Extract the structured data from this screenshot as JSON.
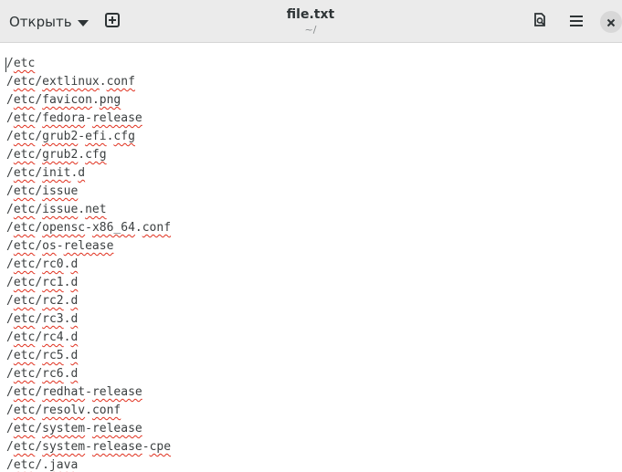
{
  "header": {
    "open_label": "Открыть",
    "title": "file.txt",
    "subtitle": "~/",
    "icons": {
      "open_dropdown": "chevron-down-icon",
      "new_tab": "new-tab-icon",
      "search": "search-icon",
      "menu": "hamburger-menu-icon",
      "close": "close-icon"
    }
  },
  "editor": {
    "lines": [
      "/etc",
      "/etc/extlinux.conf",
      "/etc/favicon.png",
      "/etc/fedora-release",
      "/etc/grub2-efi.cfg",
      "/etc/grub2.cfg",
      "/etc/init.d",
      "/etc/issue",
      "/etc/issue.net",
      "/etc/opensc-x86_64.conf",
      "/etc/os-release",
      "/etc/rc0.d",
      "/etc/rc1.d",
      "/etc/rc2.d",
      "/etc/rc3.d",
      "/etc/rc4.d",
      "/etc/rc5.d",
      "/etc/rc6.d",
      "/etc/redhat-release",
      "/etc/resolv.conf",
      "/etc/system-release",
      "/etc/system-release-cpe",
      "/etc/.java"
    ]
  },
  "colors": {
    "headerbar": "#ebebeb",
    "text": "#3b3f40",
    "spell_underline": "#e0301e"
  }
}
